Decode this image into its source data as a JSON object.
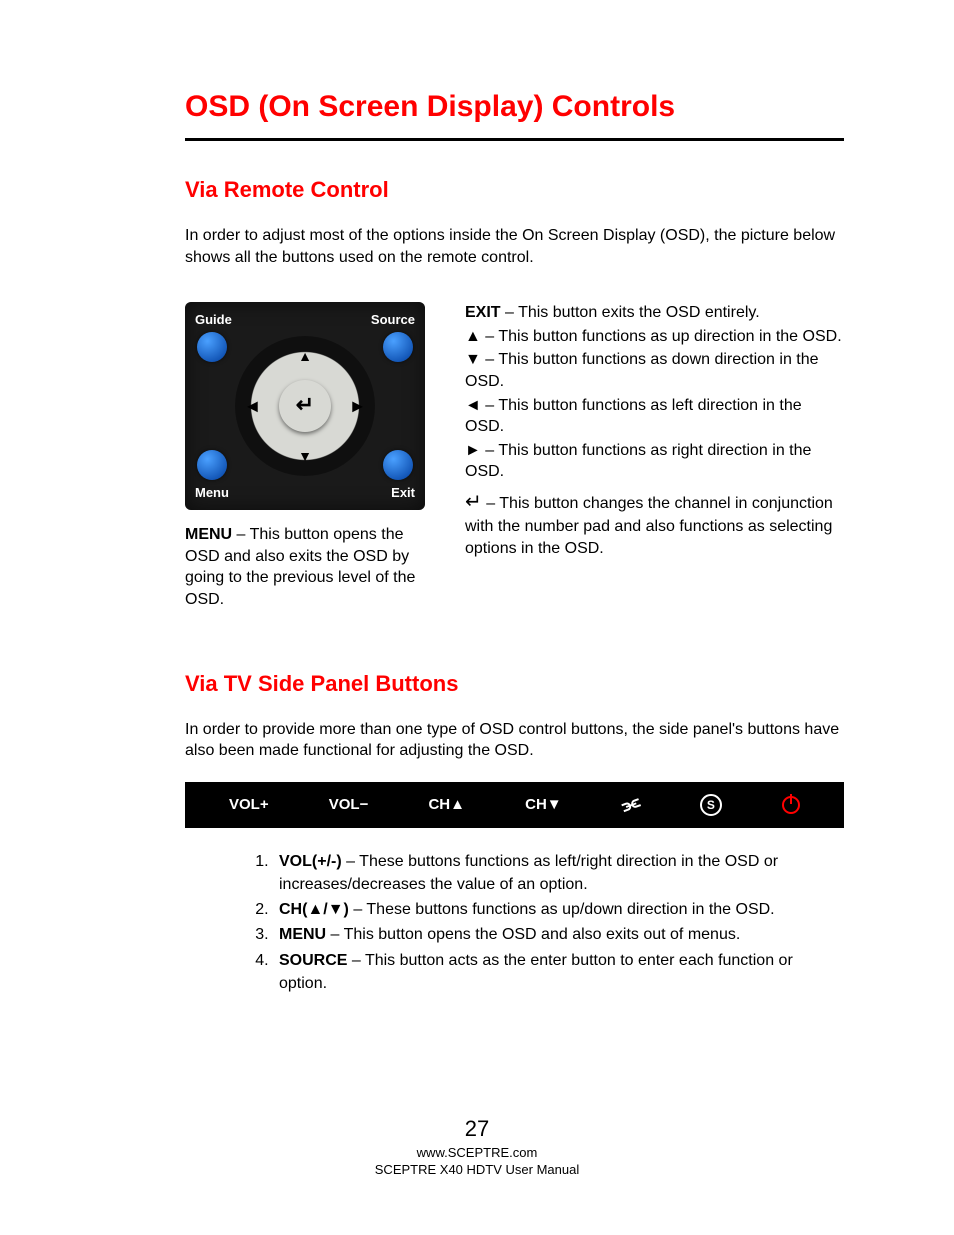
{
  "title": "OSD (On Screen Display) Controls",
  "section1": {
    "heading": "Via Remote Control",
    "intro": "In order to adjust most of the options inside the On Screen Display (OSD), the picture below shows all the buttons used on the remote control.",
    "remote_labels": {
      "guide": "Guide",
      "source": "Source",
      "menu": "Menu",
      "exit": "Exit"
    },
    "menu_label": "MENU",
    "menu_desc": " – This button opens the OSD and also exits the OSD by going to the previous level of the OSD.",
    "right": {
      "exit_label": "EXIT",
      "exit_desc": " – This button exits the OSD entirely.",
      "up_sym": "▲",
      "up_desc": " – This button functions as up direction in the OSD.",
      "down_sym": "▼",
      "down_desc": " – This button functions as down direction in the OSD.",
      "left_sym": "◄",
      "left_desc": " – This button functions as left direction in the OSD.",
      "right_sym": "►",
      "right_desc": " – This button functions as right direction in the OSD.",
      "enter_sym": "↵",
      "enter_desc": " – This button changes the channel in conjunction with the number pad and also functions as selecting options in the OSD."
    }
  },
  "section2": {
    "heading": "Via TV Side Panel Buttons",
    "intro": "In order to provide more than one type of OSD control buttons, the side panel's buttons have also been made functional for adjusting the OSD.",
    "strip": {
      "volup": "VOL+",
      "voldown": "VOL−",
      "chup": "CH▲",
      "chdown": "CH▼",
      "source_letter": "S"
    },
    "list": [
      {
        "label": "VOL(+/-)",
        "desc": " – These buttons functions as left/right direction in the OSD or increases/decreases the value of an option."
      },
      {
        "label": "CH(▲/▼)",
        "desc": " – These buttons functions as up/down direction in the OSD."
      },
      {
        "label": "MENU",
        "desc": " – This button opens the OSD and also exits out of menus."
      },
      {
        "label": "SOURCE",
        "desc": " – This button acts as the enter button to enter each function or option."
      }
    ]
  },
  "footer": {
    "page": "27",
    "url": "www.SCEPTRE.com",
    "manual": "SCEPTRE X40 HDTV User Manual"
  }
}
